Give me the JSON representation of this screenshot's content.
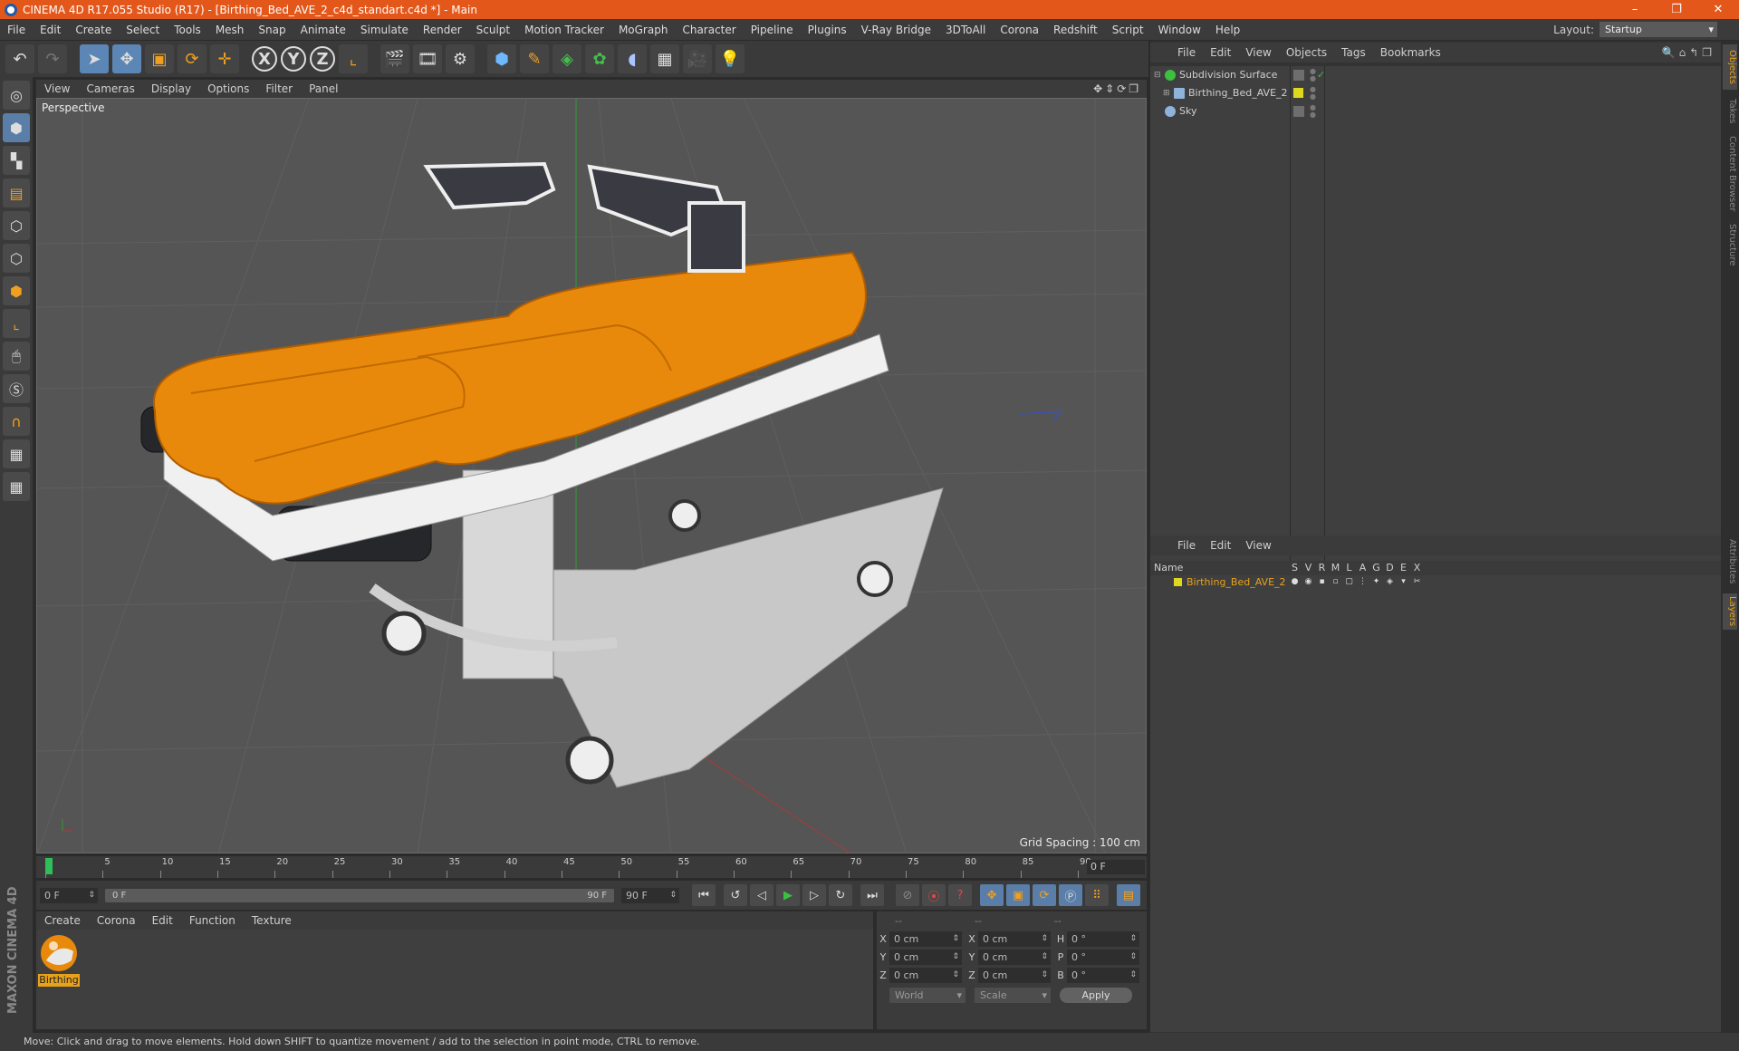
{
  "window": {
    "title": "CINEMA 4D R17.055 Studio (R17) - [Birthing_Bed_AVE_2_c4d_standart.c4d *] - Main",
    "controls": [
      "–",
      "❐",
      "✕"
    ]
  },
  "menu": {
    "items": [
      "File",
      "Edit",
      "Create",
      "Select",
      "Tools",
      "Mesh",
      "Snap",
      "Animate",
      "Simulate",
      "Render",
      "Sculpt",
      "Motion Tracker",
      "MoGraph",
      "Character",
      "Pipeline",
      "Plugins",
      "V-Ray Bridge",
      "3DToAll",
      "Corona",
      "Redshift",
      "Script",
      "Window",
      "Help"
    ],
    "layout_label": "Layout:",
    "layout_value": "Startup"
  },
  "toolbar": {
    "axis_x": "X",
    "axis_y": "Y",
    "axis_z": "Z"
  },
  "viewport": {
    "menu": [
      "View",
      "Cameras",
      "Display",
      "Options",
      "Filter",
      "Panel"
    ],
    "label": "Perspective",
    "grid_spacing": "Grid Spacing : 100 cm"
  },
  "timeline": {
    "ticks": [
      "0",
      "5",
      "10",
      "15",
      "20",
      "25",
      "30",
      "35",
      "40",
      "45",
      "50",
      "55",
      "60",
      "65",
      "70",
      "75",
      "80",
      "85",
      "90"
    ],
    "current_frame": "0 F",
    "start_field": "0 F",
    "range_start": "0 F",
    "range_end": "90 F",
    "end_field": "90 F"
  },
  "materials": {
    "menu": [
      "Create",
      "Corona",
      "Edit",
      "Function",
      "Texture"
    ],
    "items": [
      {
        "name": "Birthing"
      }
    ]
  },
  "coords": {
    "headers": [
      "--",
      "--",
      "--"
    ],
    "rows": [
      {
        "a": "X",
        "av": "0 cm",
        "b": "X",
        "bv": "0 cm",
        "c": "H",
        "cv": "0 °"
      },
      {
        "a": "Y",
        "av": "0 cm",
        "b": "Y",
        "bv": "0 cm",
        "c": "P",
        "cv": "0 °"
      },
      {
        "a": "Z",
        "av": "0 cm",
        "b": "Z",
        "bv": "0 cm",
        "c": "B",
        "cv": "0 °"
      }
    ],
    "mode": "World",
    "size_mode": "Scale",
    "apply": "Apply"
  },
  "object_manager": {
    "menu": [
      "File",
      "Edit",
      "View",
      "Objects",
      "Tags",
      "Bookmarks"
    ],
    "objects": [
      {
        "name": "Subdivision Surface",
        "icon_color": "#3fbf3f"
      },
      {
        "name": "Birthing_Bed_AVE_2",
        "icon_color": "#8fb4dc"
      },
      {
        "name": "Sky",
        "icon_color": "#8fb4dc"
      }
    ]
  },
  "layer_manager": {
    "menu": [
      "File",
      "Edit",
      "View"
    ],
    "columns": [
      "Name",
      "S",
      "V",
      "R",
      "M",
      "L",
      "A",
      "G",
      "D",
      "E",
      "X"
    ],
    "layers": [
      {
        "name": "Birthing_Bed_AVE_2",
        "color": "#e0d81d"
      }
    ]
  },
  "side_tabs": [
    "Objects",
    "Takes",
    "Content Browser",
    "Structure",
    "Attributes",
    "Layers"
  ],
  "branding": "MAXON CINEMA 4D",
  "status": "Move: Click and drag to move elements. Hold down SHIFT to quantize movement / add to the selection in point mode, CTRL to remove.",
  "colors": {
    "accent_orange": "#e4571a",
    "selection_blue": "#5b86b5",
    "material_orange": "#e8a21a"
  }
}
